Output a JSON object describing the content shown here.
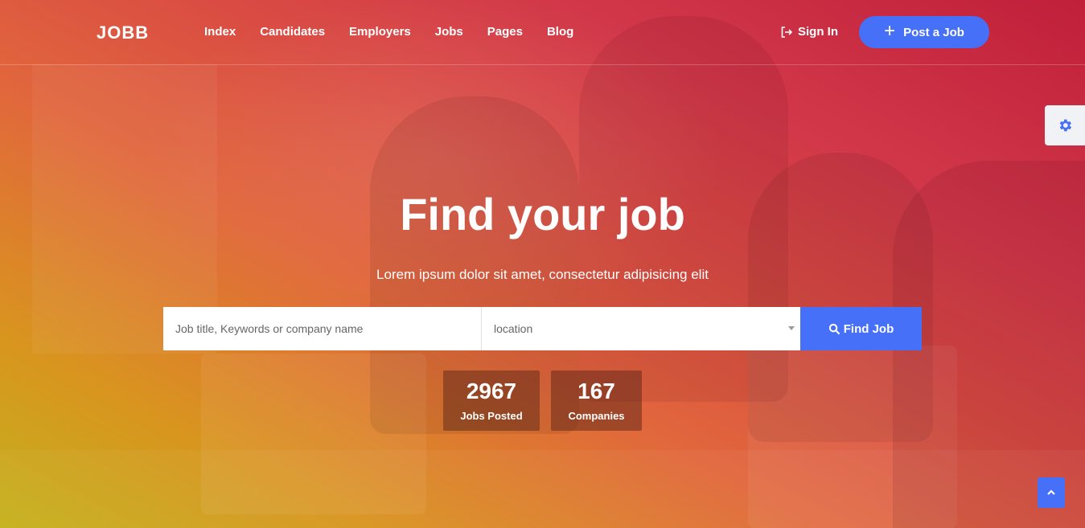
{
  "brand": {
    "logo": "JOBB"
  },
  "nav": {
    "items": [
      {
        "label": "Index"
      },
      {
        "label": "Candidates"
      },
      {
        "label": "Employers"
      },
      {
        "label": "Jobs"
      },
      {
        "label": "Pages"
      },
      {
        "label": "Blog"
      }
    ],
    "sign_in": "Sign In",
    "post_job": "Post a Job"
  },
  "hero": {
    "title": "Find your job",
    "subtitle": "Lorem ipsum dolor sit amet, consectetur adipisicing elit"
  },
  "search": {
    "keyword_placeholder": "Job title, Keywords or company name",
    "location_value": "location",
    "button_label": "Find Job"
  },
  "stats": {
    "jobs": {
      "value": "2967",
      "label": "Jobs Posted"
    },
    "companies": {
      "value": "167",
      "label": "Companies"
    }
  },
  "icons": {
    "sign_in": "sign-in-icon",
    "post_job": "plus-icon",
    "settings": "gear-icon",
    "search": "search-icon",
    "to_top": "chevron-up-icon"
  },
  "colors": {
    "accent": "#4670f8",
    "gradient_start": "#c4b11c",
    "gradient_mid": "#e1673c",
    "gradient_end": "#c0203a"
  }
}
